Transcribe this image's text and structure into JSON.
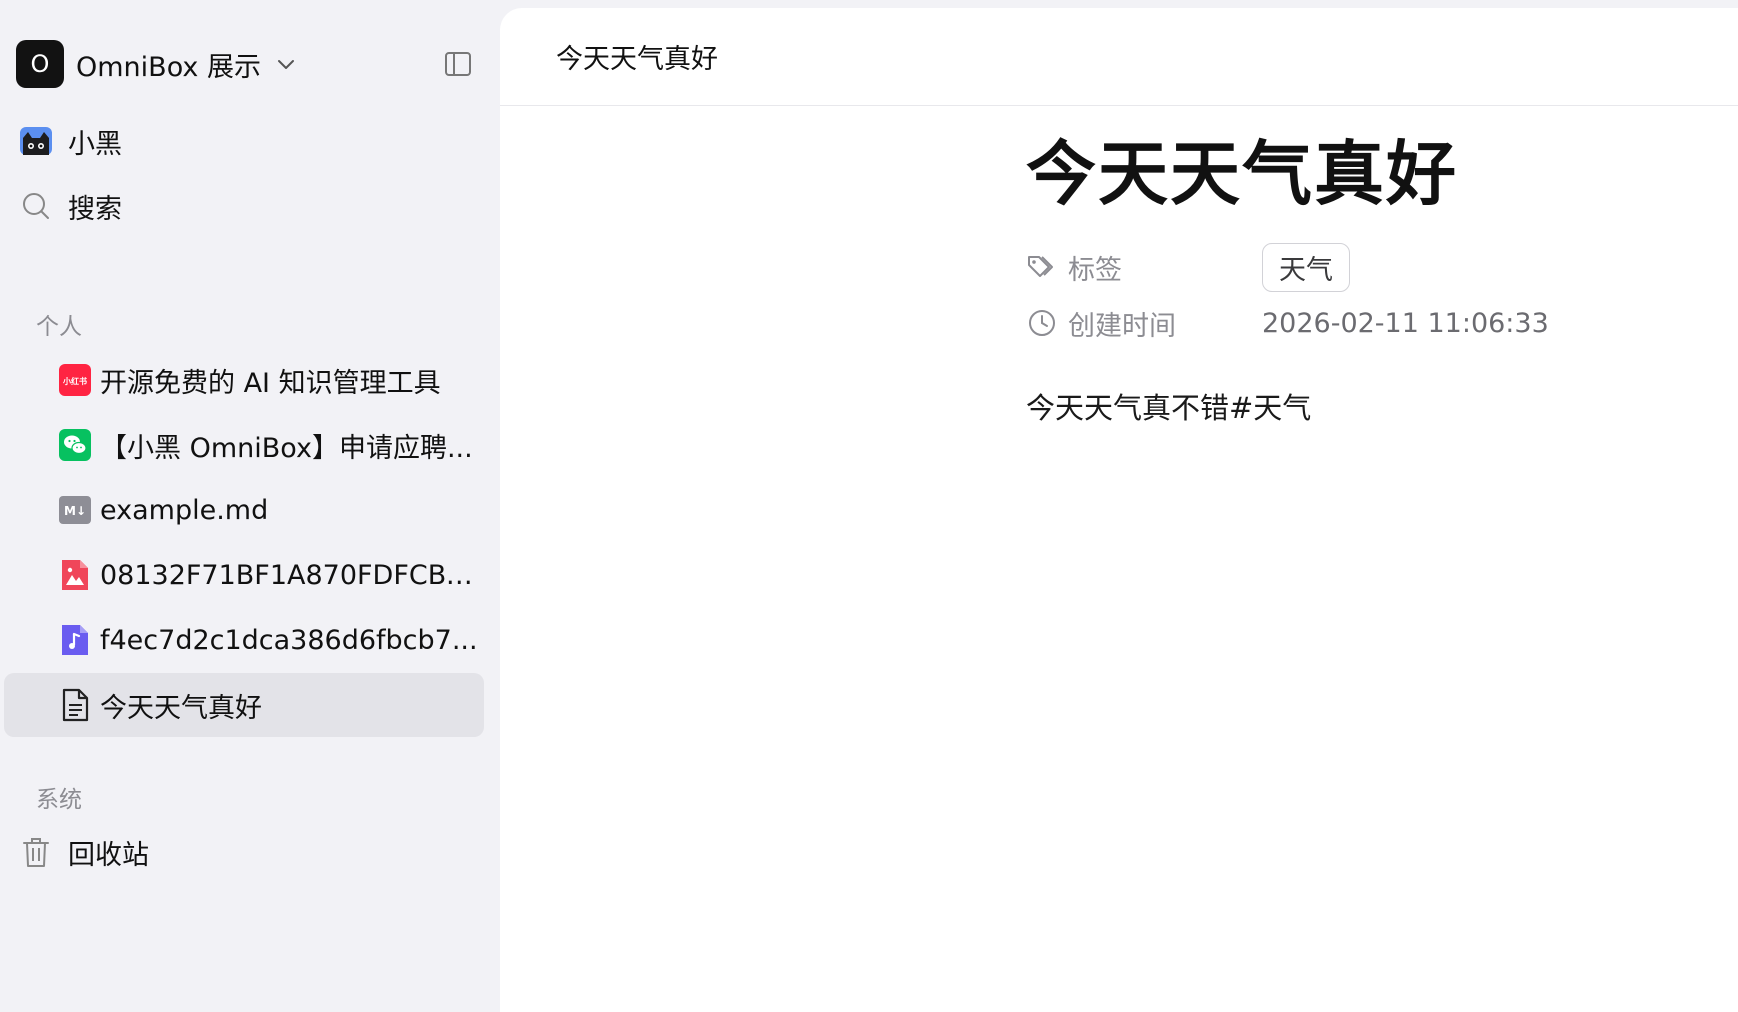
{
  "workspace": {
    "avatar_letter": "O",
    "name": "OmniBox 展示"
  },
  "nav": {
    "assistant_label": "小黑",
    "search_label": "搜索",
    "trash_label": "回收站"
  },
  "sections": {
    "personal": "个人",
    "system": "系统"
  },
  "files": [
    {
      "label": "开源免费的 AI 知识管理工具",
      "icon": "xiaohongshu-icon",
      "badge_text": "小红书"
    },
    {
      "label": "【小黑 OmniBox】申请应聘...",
      "icon": "wechat-icon"
    },
    {
      "label": "example.md",
      "icon": "markdown-icon",
      "badge_text": "M↓"
    },
    {
      "label": "08132F71BF1A870FDFCBC...",
      "icon": "image-file-icon"
    },
    {
      "label": "f4ec7d2c1dca386d6fbcb7...",
      "icon": "audio-file-icon"
    },
    {
      "label": "今天天气真好",
      "icon": "document-icon",
      "active": true
    }
  ],
  "topbar": {
    "title": "今天天气真好"
  },
  "document": {
    "title": "今天天气真好",
    "properties": {
      "tags_label": "标签",
      "tags": [
        "天气"
      ],
      "created_label": "创建时间",
      "created_value": "2026-02-11 11:06:33"
    },
    "body": "今天天气真不错#天气"
  },
  "colors": {
    "sidebar_bg": "#f2f2f6",
    "active_item_bg": "#e3e3e8",
    "xiaohongshu_red": "#ff2442",
    "wechat_green": "#07c160",
    "image_icon_red": "#f0465a",
    "audio_icon_purple": "#6a5cf0",
    "markdown_gray": "#8e8e96"
  }
}
